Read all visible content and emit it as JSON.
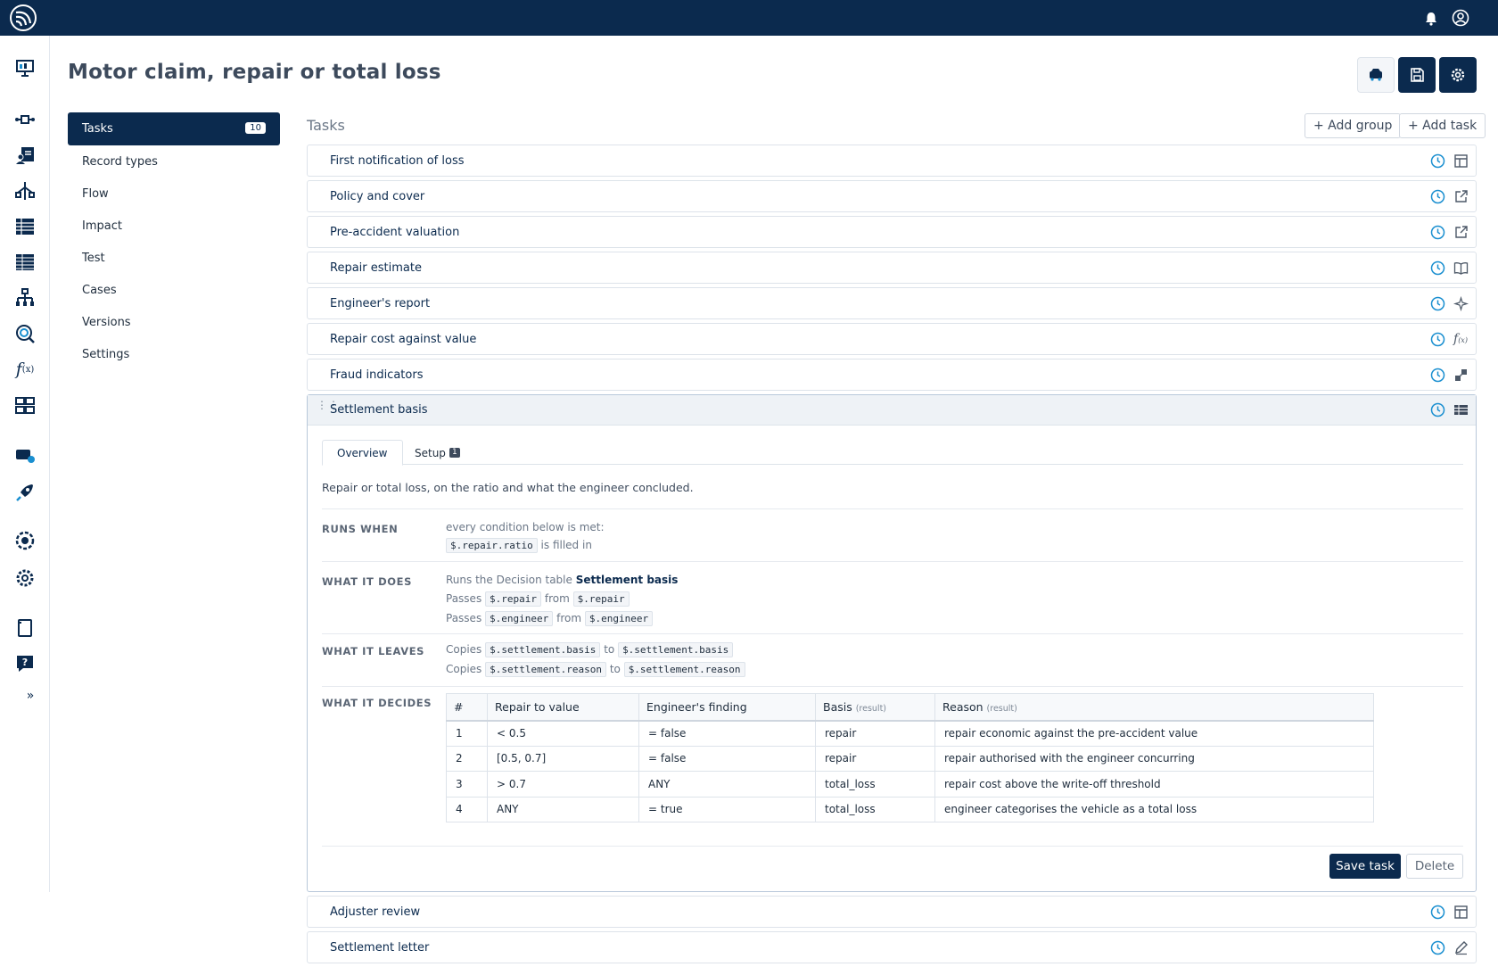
{
  "page": {
    "title": "Motor claim, repair or total loss"
  },
  "subnav": {
    "active": {
      "label": "Tasks",
      "count": "10"
    },
    "items": [
      "Record types",
      "Flow",
      "Impact",
      "Test",
      "Cases",
      "Versions",
      "Settings"
    ]
  },
  "tasks": {
    "label": "Tasks",
    "add_group": "+ Add group",
    "add_task": "+ Add task",
    "rows": [
      {
        "label": "First notification of loss",
        "icon": "form-icon"
      },
      {
        "label": "Policy and cover",
        "icon": "external-link-icon"
      },
      {
        "label": "Pre-accident valuation",
        "icon": "external-link-icon"
      },
      {
        "label": "Repair estimate",
        "icon": "book-icon"
      },
      {
        "label": "Engineer's report",
        "icon": "sparkle-icon"
      },
      {
        "label": "Repair cost against value",
        "icon": "function-icon"
      },
      {
        "label": "Fraud indicators",
        "icon": "script-icon"
      }
    ],
    "after_rows": [
      {
        "label": "Adjuster review",
        "icon": "form-icon"
      },
      {
        "label": "Settlement letter",
        "icon": "pencil-icon"
      }
    ]
  },
  "expanded": {
    "label": "Settlement basis",
    "tabs": {
      "overview": "Overview",
      "setup": "Setup",
      "setup_badge": "1"
    },
    "description": "Repair or total loss, on the ratio and what the engineer concluded.",
    "runs_when": {
      "label": "RUNS WHEN",
      "line1": "every condition below is met:",
      "code": "$.repair.ratio",
      "suffix": "is filled in"
    },
    "what_it_does": {
      "label": "WHAT IT DOES",
      "prefix": "Runs the Decision table",
      "target": "Settlement basis",
      "passes": [
        {
          "word": "Passes",
          "a": "$.repair",
          "from": "from",
          "b": "$.repair"
        },
        {
          "word": "Passes",
          "a": "$.engineer",
          "from": "from",
          "b": "$.engineer"
        }
      ]
    },
    "what_it_leaves": {
      "label": "WHAT IT LEAVES",
      "copies": [
        {
          "word": "Copies",
          "a": "$.settlement.basis",
          "to": "to",
          "b": "$.settlement.basis"
        },
        {
          "word": "Copies",
          "a": "$.settlement.reason",
          "to": "to",
          "b": "$.settlement.reason"
        }
      ]
    },
    "what_it_decides": {
      "label": "WHAT IT DECIDES",
      "headers": [
        "#",
        "Repair to value",
        "Engineer's finding",
        "Basis",
        "Reason"
      ],
      "result_tag": "(result)",
      "rows": [
        [
          "1",
          "< 0.5",
          "= false",
          "repair",
          "repair economic against the pre-accident value"
        ],
        [
          "2",
          "[0.5, 0.7]",
          "= false",
          "repair",
          "repair authorised with the engineer concurring"
        ],
        [
          "3",
          "> 0.7",
          "ANY",
          "total_loss",
          "repair cost above the write-off threshold"
        ],
        [
          "4",
          "ANY",
          "= true",
          "total_loss",
          "engineer categorises the vehicle as a total loss"
        ]
      ]
    },
    "save": "Save task",
    "delete": "Delete"
  },
  "colors": {
    "brand": "#0b2a4e",
    "accent": "#1a8fd0"
  }
}
